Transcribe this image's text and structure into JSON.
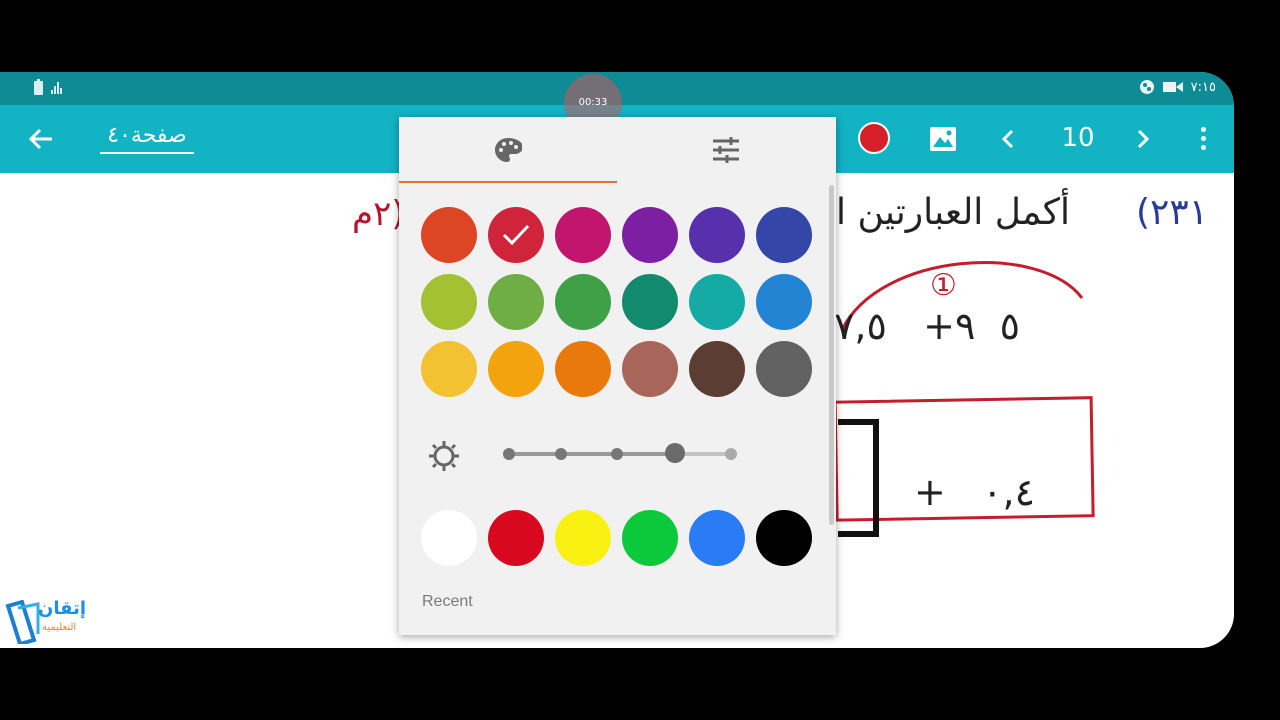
{
  "statusbar": {
    "time": "٧:١٥"
  },
  "appbar": {
    "page_title": "صفحة٤٠",
    "page_number": "10"
  },
  "recording": {
    "timer": "00:33"
  },
  "document": {
    "question_number": "٢٣١)",
    "question_text": "أكمل العبارتين ا",
    "red_text": "(٢م",
    "expr1": "٥  ٩+   ٧,٥",
    "circled": "①",
    "expr2": "+   ٠,٤"
  },
  "logo": {
    "text": "إتقان",
    "subtext": "التعليمية"
  },
  "color_picker": {
    "palette_rows": [
      [
        "#dc4625",
        "#d0243a",
        "#c2166e",
        "#7c1fa2",
        "#5730ad",
        "#3446a8"
      ],
      [
        "#a3c133",
        "#6fae44",
        "#40a047",
        "#128a6e",
        "#16aaa5",
        "#2284d3"
      ],
      [
        "#f3c232",
        "#f3a30e",
        "#e9790d",
        "#a8665a",
        "#5b3d34",
        "#626262"
      ]
    ],
    "selected_index": [
      0,
      1
    ],
    "basic_colors": [
      "#ffffff",
      "#d8081f",
      "#f9f111",
      "#0bc93b",
      "#2a7bf4",
      "#000000"
    ],
    "recent_label": "Recent"
  }
}
